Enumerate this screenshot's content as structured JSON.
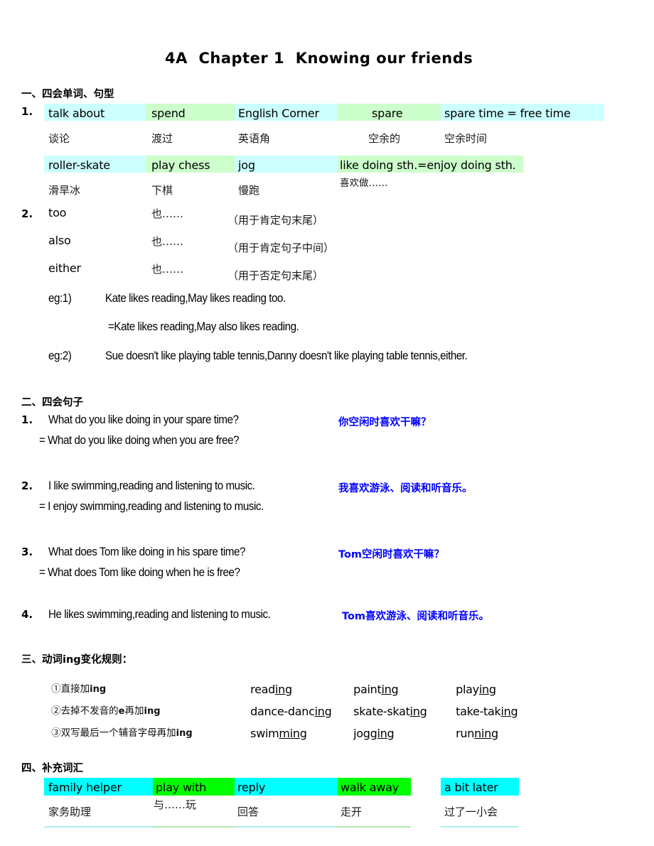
{
  "document": {
    "title": "4A  Chapter 1  Knowing our friends"
  },
  "colors": {
    "pale_cyan": "#CCFFFF",
    "pale_green": "#CCFFCC",
    "bright_cyan": "#00FFFF",
    "bright_green": "#00FF00",
    "translation_blue": "#0000FF",
    "text_black": "#000000"
  },
  "section1": {
    "heading": "一、四会单词、句型",
    "number": "1.",
    "vocab_rows": [
      {
        "words": [
          {
            "text": "talk about",
            "highlight": "pale_cyan",
            "gloss": "谈论"
          },
          {
            "text": "spend",
            "highlight": "pale_green",
            "gloss": "渡过"
          },
          {
            "text": "English Corner",
            "highlight": "pale_cyan",
            "gloss": "英语角"
          },
          {
            "text": "spare",
            "highlight": "pale_green",
            "gloss": "空余的"
          },
          {
            "text": "spare time = free time",
            "highlight": "pale_cyan",
            "gloss": "空余时间"
          }
        ]
      },
      {
        "words": [
          {
            "text": "roller-skate",
            "highlight": "pale_cyan",
            "gloss": "滑旱冰"
          },
          {
            "text": "play chess",
            "highlight": "pale_green",
            "gloss": "下棋"
          },
          {
            "text": "jog",
            "highlight": "pale_cyan",
            "gloss": "慢跑"
          },
          {
            "text": "like doing sth.=enjoy doing sth.",
            "highlight": "pale_green",
            "gloss": "喜欢做……"
          }
        ]
      }
    ],
    "item2": {
      "number": "2.",
      "rows": [
        {
          "word": "too",
          "gloss": "也……",
          "note": "（用于肯定句末尾）"
        },
        {
          "word": "also",
          "gloss": "也……",
          "note": "（用于肯定句子中间）"
        },
        {
          "word": "either",
          "gloss": "也……",
          "note": "（用于否定句末尾）"
        }
      ],
      "examples": [
        {
          "label": "eg:1)",
          "lines": [
            "Kate likes reading,May likes reading too.",
            "=Kate likes reading,May also likes reading."
          ]
        },
        {
          "label": "eg:2)",
          "lines": [
            "Sue doesn't like playing table tennis,Danny doesn't like playing table tennis,either."
          ]
        }
      ]
    }
  },
  "section2": {
    "heading": "二、四会句子",
    "items": [
      {
        "number": "1.",
        "line1": "What do you like doing in your spare time?",
        "line2": "= What do you like doing when you are free?",
        "translation": "你空闲时喜欢干嘛？"
      },
      {
        "number": "2.",
        "line1": "I like swimming,reading and listening to music.",
        "line2": "= I enjoy swimming,reading and listening to music.",
        "translation": "我喜欢游泳、阅读和听音乐。"
      },
      {
        "number": "3.",
        "line1": "What does Tom like doing in his spare time?",
        "line2": "= What does Tom like doing when he is free?",
        "translation": "Tom空闲时喜欢干嘛？"
      },
      {
        "number": "4.",
        "line1": "He likes swimming,reading and listening to music.",
        "line2": "",
        "translation": "Tom喜欢游泳、阅读和听音乐。"
      }
    ]
  },
  "section3": {
    "heading": "三、动词ing变化规则：",
    "rules": [
      {
        "label_prefix": "①直接加",
        "label_bold": "ing",
        "label_suffix": "",
        "examples": [
          {
            "stem": "read",
            "suffix": "ing"
          },
          {
            "stem": "paint",
            "suffix": "ing"
          },
          {
            "stem": "play",
            "suffix": "ing"
          }
        ]
      },
      {
        "label_prefix": "②去掉不发音的",
        "label_bold": "e",
        "label_mid": "再加",
        "label_bold2": "ing",
        "examples": [
          {
            "stem": "dance-danc",
            "suffix": "ing"
          },
          {
            "stem": "skate-skat",
            "suffix": "ing"
          },
          {
            "stem": "take-tak",
            "suffix": "ing"
          }
        ]
      },
      {
        "label_prefix": "③双写最后一个辅音字母再加",
        "label_bold": "ing",
        "examples": [
          {
            "stem": "swim",
            "suffix": "ming"
          },
          {
            "stem": "jog",
            "suffix": "ging"
          },
          {
            "stem": "run",
            "suffix": "ning"
          }
        ]
      }
    ]
  },
  "section4": {
    "heading": "四、补充词汇",
    "words": [
      {
        "text": "family helper",
        "highlight": "bright_cyan",
        "gloss": "家务助理"
      },
      {
        "text": "play with",
        "highlight": "bright_green",
        "gloss": "与……玩"
      },
      {
        "text": "reply",
        "highlight": "bright_cyan",
        "gloss": "回答"
      },
      {
        "text": "walk away",
        "highlight": "bright_green",
        "gloss": "走开"
      },
      {
        "text": "a bit later",
        "highlight": "bright_cyan",
        "gloss": "过了一小会"
      }
    ]
  }
}
